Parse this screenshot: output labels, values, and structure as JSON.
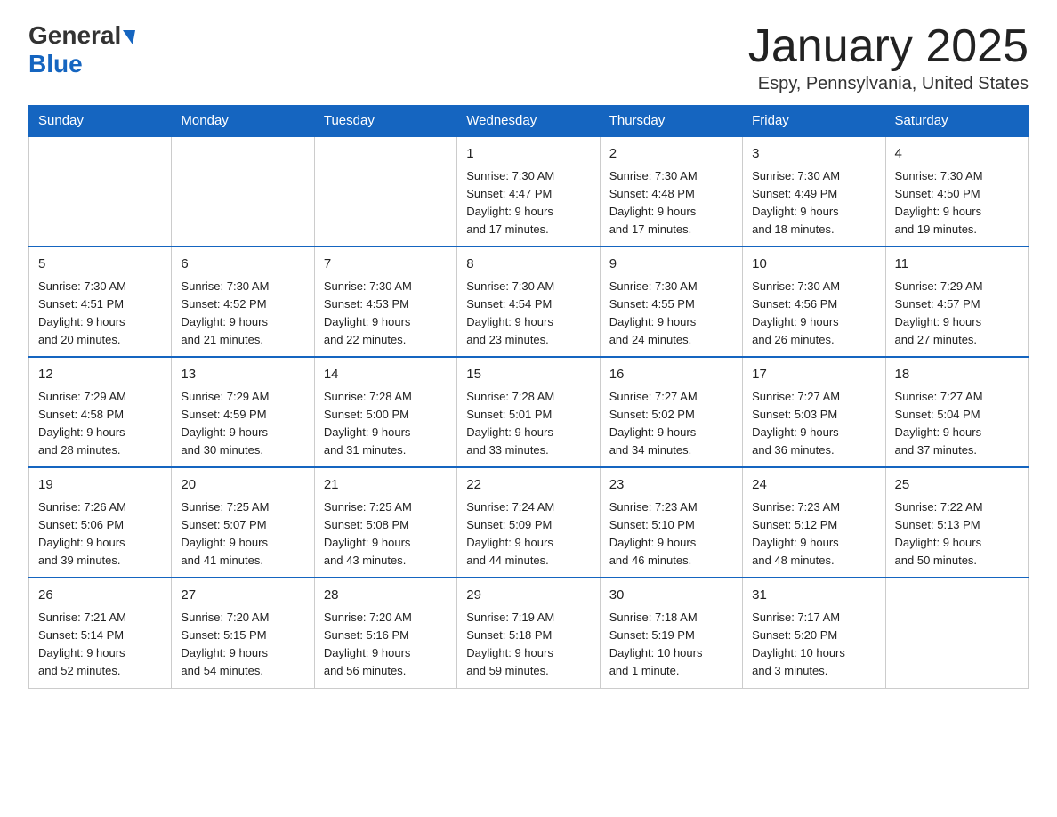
{
  "header": {
    "logo_general": "General",
    "logo_blue": "Blue",
    "title": "January 2025",
    "subtitle": "Espy, Pennsylvania, United States"
  },
  "days_of_week": [
    "Sunday",
    "Monday",
    "Tuesday",
    "Wednesday",
    "Thursday",
    "Friday",
    "Saturday"
  ],
  "weeks": [
    [
      {
        "day": "",
        "info": ""
      },
      {
        "day": "",
        "info": ""
      },
      {
        "day": "",
        "info": ""
      },
      {
        "day": "1",
        "info": "Sunrise: 7:30 AM\nSunset: 4:47 PM\nDaylight: 9 hours\nand 17 minutes."
      },
      {
        "day": "2",
        "info": "Sunrise: 7:30 AM\nSunset: 4:48 PM\nDaylight: 9 hours\nand 17 minutes."
      },
      {
        "day": "3",
        "info": "Sunrise: 7:30 AM\nSunset: 4:49 PM\nDaylight: 9 hours\nand 18 minutes."
      },
      {
        "day": "4",
        "info": "Sunrise: 7:30 AM\nSunset: 4:50 PM\nDaylight: 9 hours\nand 19 minutes."
      }
    ],
    [
      {
        "day": "5",
        "info": "Sunrise: 7:30 AM\nSunset: 4:51 PM\nDaylight: 9 hours\nand 20 minutes."
      },
      {
        "day": "6",
        "info": "Sunrise: 7:30 AM\nSunset: 4:52 PM\nDaylight: 9 hours\nand 21 minutes."
      },
      {
        "day": "7",
        "info": "Sunrise: 7:30 AM\nSunset: 4:53 PM\nDaylight: 9 hours\nand 22 minutes."
      },
      {
        "day": "8",
        "info": "Sunrise: 7:30 AM\nSunset: 4:54 PM\nDaylight: 9 hours\nand 23 minutes."
      },
      {
        "day": "9",
        "info": "Sunrise: 7:30 AM\nSunset: 4:55 PM\nDaylight: 9 hours\nand 24 minutes."
      },
      {
        "day": "10",
        "info": "Sunrise: 7:30 AM\nSunset: 4:56 PM\nDaylight: 9 hours\nand 26 minutes."
      },
      {
        "day": "11",
        "info": "Sunrise: 7:29 AM\nSunset: 4:57 PM\nDaylight: 9 hours\nand 27 minutes."
      }
    ],
    [
      {
        "day": "12",
        "info": "Sunrise: 7:29 AM\nSunset: 4:58 PM\nDaylight: 9 hours\nand 28 minutes."
      },
      {
        "day": "13",
        "info": "Sunrise: 7:29 AM\nSunset: 4:59 PM\nDaylight: 9 hours\nand 30 minutes."
      },
      {
        "day": "14",
        "info": "Sunrise: 7:28 AM\nSunset: 5:00 PM\nDaylight: 9 hours\nand 31 minutes."
      },
      {
        "day": "15",
        "info": "Sunrise: 7:28 AM\nSunset: 5:01 PM\nDaylight: 9 hours\nand 33 minutes."
      },
      {
        "day": "16",
        "info": "Sunrise: 7:27 AM\nSunset: 5:02 PM\nDaylight: 9 hours\nand 34 minutes."
      },
      {
        "day": "17",
        "info": "Sunrise: 7:27 AM\nSunset: 5:03 PM\nDaylight: 9 hours\nand 36 minutes."
      },
      {
        "day": "18",
        "info": "Sunrise: 7:27 AM\nSunset: 5:04 PM\nDaylight: 9 hours\nand 37 minutes."
      }
    ],
    [
      {
        "day": "19",
        "info": "Sunrise: 7:26 AM\nSunset: 5:06 PM\nDaylight: 9 hours\nand 39 minutes."
      },
      {
        "day": "20",
        "info": "Sunrise: 7:25 AM\nSunset: 5:07 PM\nDaylight: 9 hours\nand 41 minutes."
      },
      {
        "day": "21",
        "info": "Sunrise: 7:25 AM\nSunset: 5:08 PM\nDaylight: 9 hours\nand 43 minutes."
      },
      {
        "day": "22",
        "info": "Sunrise: 7:24 AM\nSunset: 5:09 PM\nDaylight: 9 hours\nand 44 minutes."
      },
      {
        "day": "23",
        "info": "Sunrise: 7:23 AM\nSunset: 5:10 PM\nDaylight: 9 hours\nand 46 minutes."
      },
      {
        "day": "24",
        "info": "Sunrise: 7:23 AM\nSunset: 5:12 PM\nDaylight: 9 hours\nand 48 minutes."
      },
      {
        "day": "25",
        "info": "Sunrise: 7:22 AM\nSunset: 5:13 PM\nDaylight: 9 hours\nand 50 minutes."
      }
    ],
    [
      {
        "day": "26",
        "info": "Sunrise: 7:21 AM\nSunset: 5:14 PM\nDaylight: 9 hours\nand 52 minutes."
      },
      {
        "day": "27",
        "info": "Sunrise: 7:20 AM\nSunset: 5:15 PM\nDaylight: 9 hours\nand 54 minutes."
      },
      {
        "day": "28",
        "info": "Sunrise: 7:20 AM\nSunset: 5:16 PM\nDaylight: 9 hours\nand 56 minutes."
      },
      {
        "day": "29",
        "info": "Sunrise: 7:19 AM\nSunset: 5:18 PM\nDaylight: 9 hours\nand 59 minutes."
      },
      {
        "day": "30",
        "info": "Sunrise: 7:18 AM\nSunset: 5:19 PM\nDaylight: 10 hours\nand 1 minute."
      },
      {
        "day": "31",
        "info": "Sunrise: 7:17 AM\nSunset: 5:20 PM\nDaylight: 10 hours\nand 3 minutes."
      },
      {
        "day": "",
        "info": ""
      }
    ]
  ]
}
